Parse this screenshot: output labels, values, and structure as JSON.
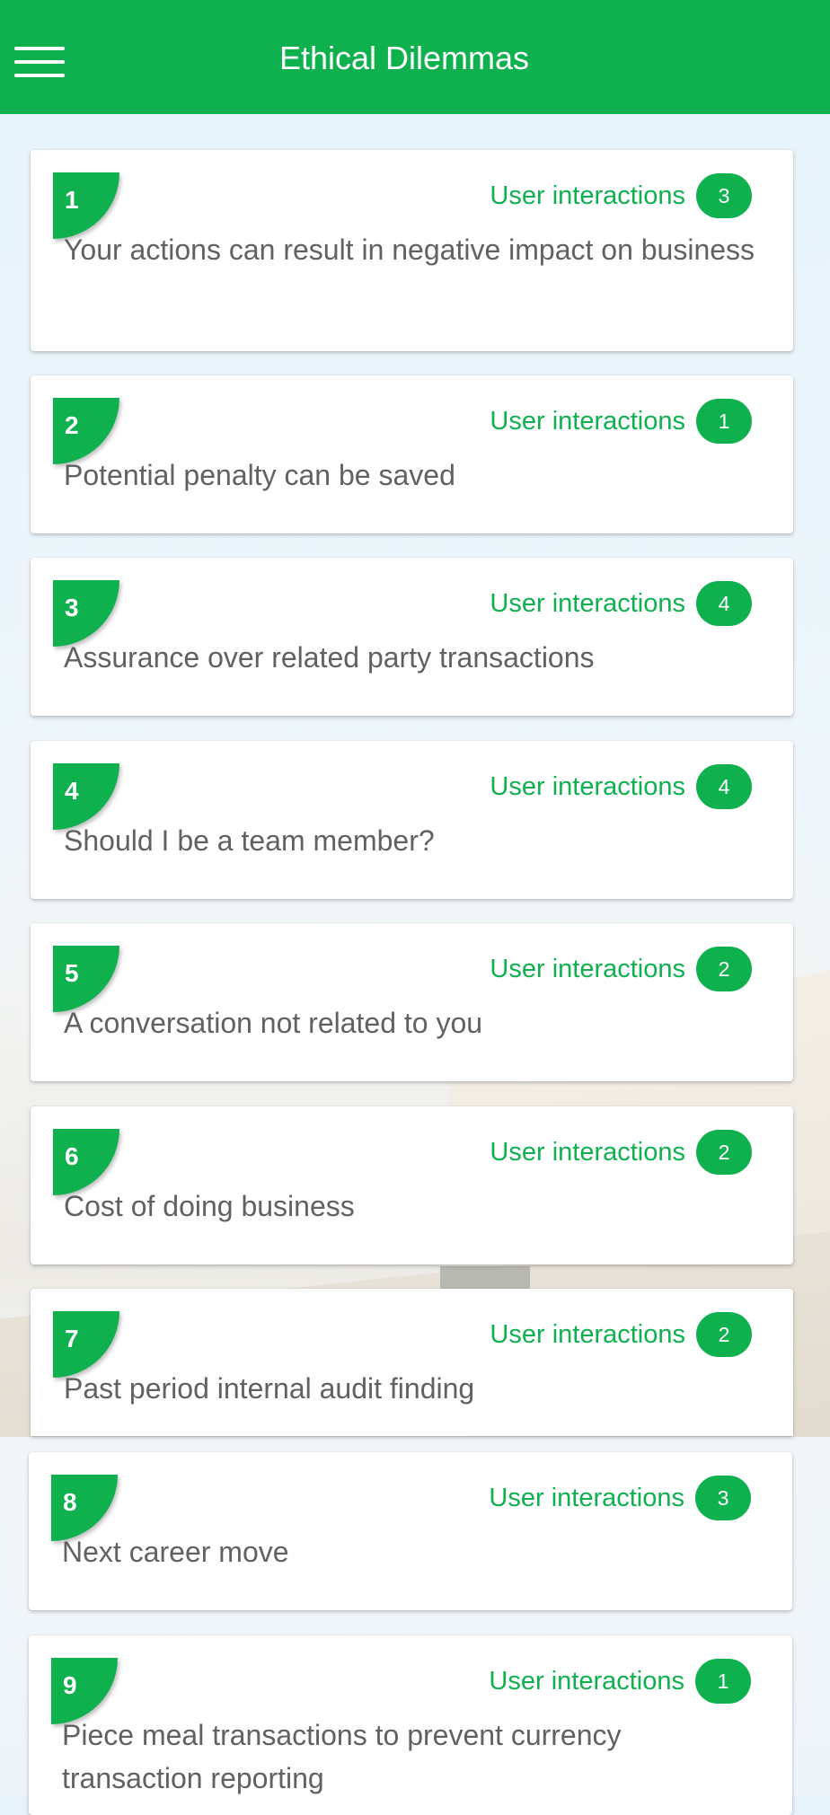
{
  "header": {
    "title": "Ethical Dilemmas",
    "menu_icon": "hamburger-menu-icon"
  },
  "colors": {
    "accent": "#0fb14f",
    "card_text": "#616161",
    "background": "#e6f3fb"
  },
  "interactions_label": "User interactions",
  "dilemmas": [
    {
      "number": "1",
      "title": "Your actions can result in negative impact on business",
      "interactions": "3"
    },
    {
      "number": "2",
      "title": "Potential penalty can be saved",
      "interactions": "1"
    },
    {
      "number": "3",
      "title": "Assurance over related party transactions",
      "interactions": "4"
    },
    {
      "number": "4",
      "title": "Should I be a team member?",
      "interactions": "4"
    },
    {
      "number": "5",
      "title": "A conversation not related to you",
      "interactions": "2"
    },
    {
      "number": "6",
      "title": "Cost of doing business",
      "interactions": "2"
    },
    {
      "number": "7",
      "title": "Past period internal audit finding",
      "interactions": "2"
    },
    {
      "number": "8",
      "title": "Next career move",
      "interactions": "3"
    },
    {
      "number": "9",
      "title": "Piece meal transactions to prevent currency transaction reporting",
      "interactions": "1"
    }
  ]
}
